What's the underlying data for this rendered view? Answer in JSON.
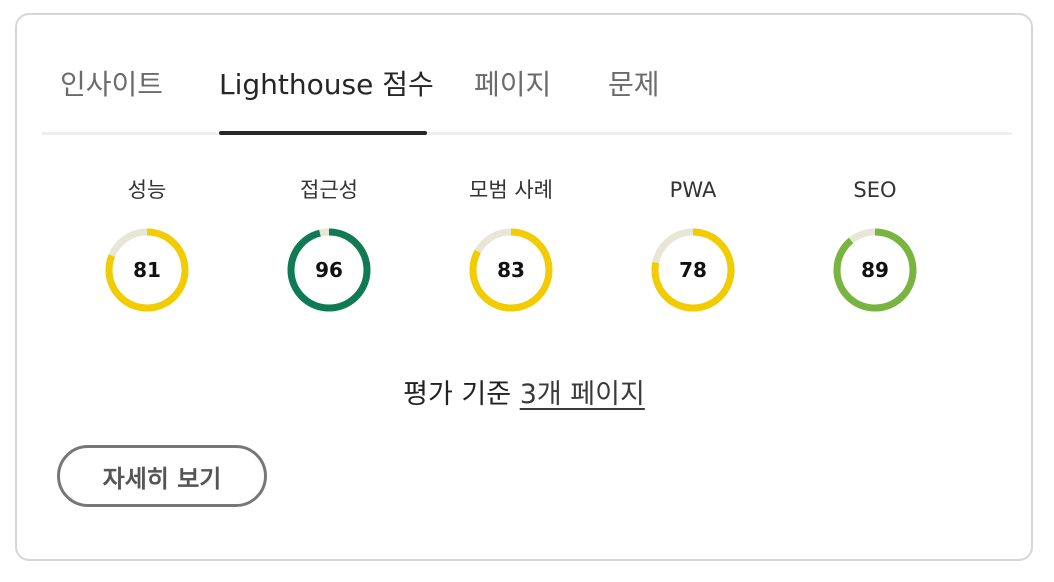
{
  "tabs": [
    {
      "label": "인사이트",
      "active": false
    },
    {
      "label": "Lighthouse 점수",
      "active": true
    },
    {
      "label": "페이지",
      "active": false
    },
    {
      "label": "문제",
      "active": false
    }
  ],
  "scores": [
    {
      "label": "성능",
      "value": 81,
      "color": "#f0cc00"
    },
    {
      "label": "접근성",
      "value": 96,
      "color": "#0f7b55"
    },
    {
      "label": "모범 사례",
      "value": 83,
      "color": "#f0cc00"
    },
    {
      "label": "PWA",
      "value": 78,
      "color": "#f0cc00"
    },
    {
      "label": "SEO",
      "value": 89,
      "color": "#7ab440"
    }
  ],
  "track_color": "#e8e6d6",
  "footer": {
    "prefix": "평가 기준",
    "link_label": "3개 페이지"
  },
  "details_button_label": "자세히 보기"
}
